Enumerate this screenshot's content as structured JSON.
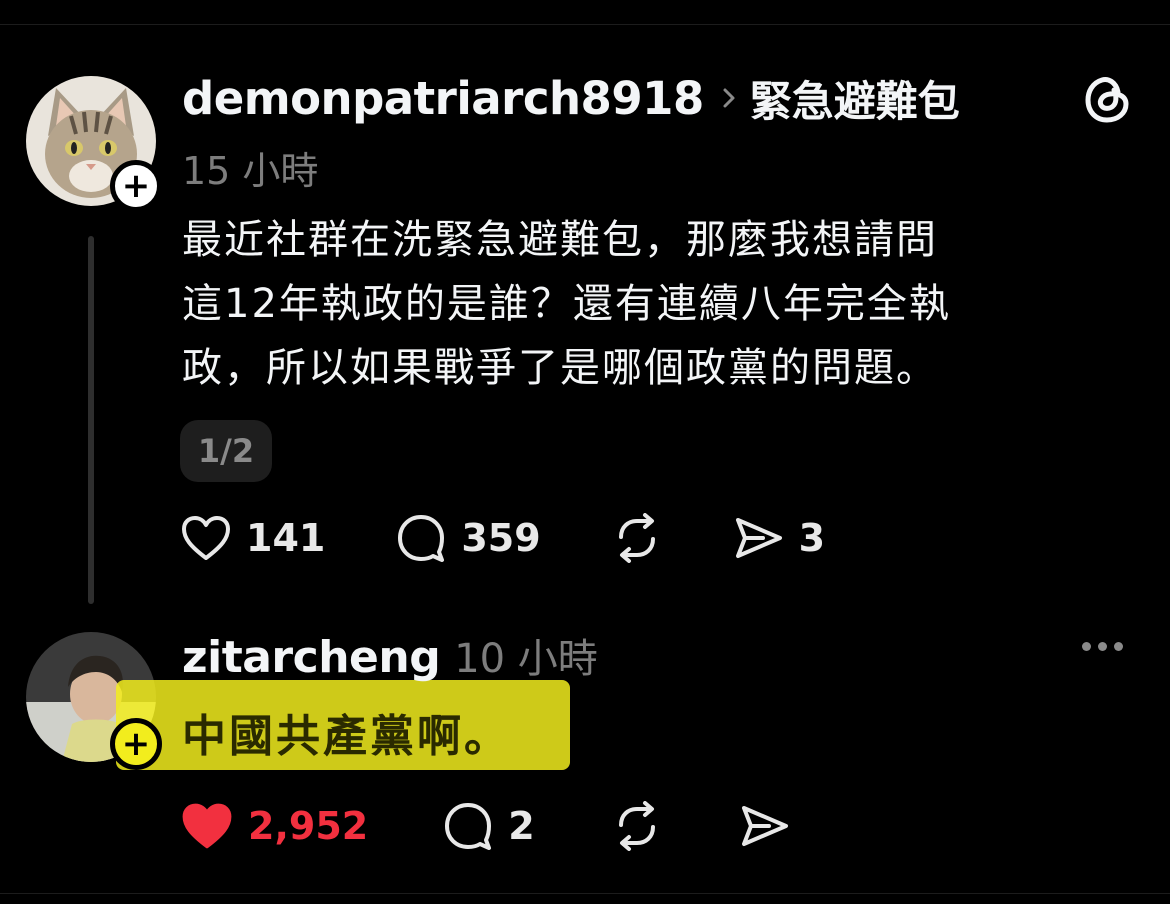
{
  "post": {
    "username": "demonpatriarch8918",
    "topic": "緊急避難包",
    "time": "15 小時",
    "lines": [
      "最近社群在洗緊急避難包，那麼我想請問",
      "這12年執政的是誰？還有連續八年完全執",
      "政，所以如果戰爭了是哪個政黨的問題。"
    ],
    "page_indicator": "1/2",
    "likes": "141",
    "comments": "359",
    "shares": "3"
  },
  "reply": {
    "username": "zitarcheng",
    "time": "10 小時",
    "text": "中國共產黨啊。",
    "likes": "2,952",
    "comments": "2"
  },
  "colors": {
    "background": "#000000",
    "highlight": "#f2ed1d",
    "liked": "#f2303f",
    "muted": "#7d7d7d"
  },
  "icons": {
    "app": "threads-icon",
    "more": "more-icon",
    "follow": "plus-icon"
  }
}
